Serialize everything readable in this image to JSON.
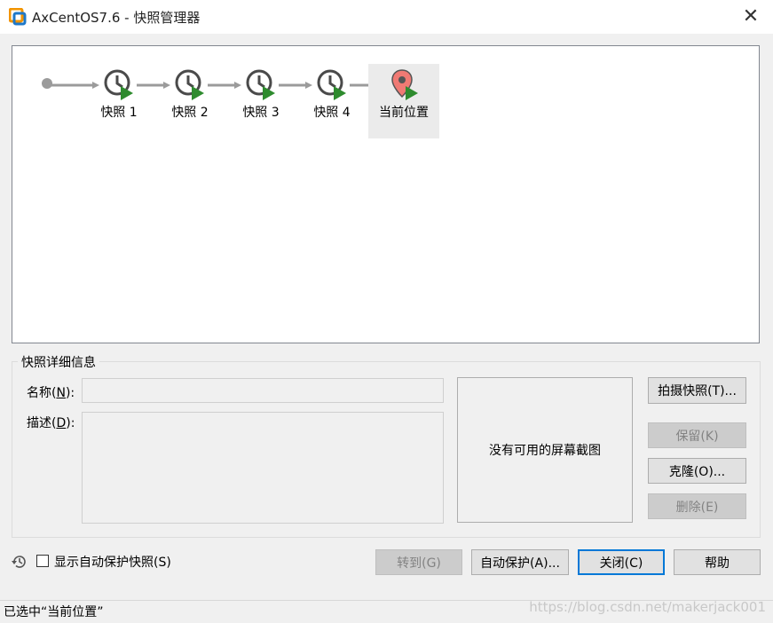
{
  "window": {
    "title": "AxCentOS7.6 - 快照管理器",
    "close_icon": "close-icon"
  },
  "tree": {
    "nodes": [
      {
        "label": "快照 1",
        "icon": "snapshot-clock-icon"
      },
      {
        "label": "快照 2",
        "icon": "snapshot-clock-icon"
      },
      {
        "label": "快照 3",
        "icon": "snapshot-clock-icon"
      },
      {
        "label": "快照 4",
        "icon": "snapshot-clock-icon"
      },
      {
        "label": "当前位置",
        "icon": "current-location-pin-icon",
        "selected": true
      }
    ],
    "colors": {
      "arrow": "#9b9b9b",
      "clock": "#4a4a4a",
      "play": "#2e8b2e",
      "pin": "#f07a74"
    }
  },
  "details": {
    "group_title": "快照详细信息",
    "name_label": "名称",
    "name_mnemonic": "N",
    "name_value": "",
    "desc_label": "描述",
    "desc_mnemonic": "D",
    "desc_value": "",
    "no_screenshot": "没有可用的屏幕截图"
  },
  "side_buttons": {
    "take": "拍摄快照(T)...",
    "keep": "保留(K)",
    "clone": "克隆(O)...",
    "delete": "删除(E)"
  },
  "bottom": {
    "history_icon": "history-icon",
    "show_autoprotect_label": "显示自动保护快照(S)",
    "show_autoprotect_checked": false,
    "goto": "转到(G)",
    "autoprotect": "自动保护(A)...",
    "close": "关闭(C)",
    "help": "帮助"
  },
  "status": {
    "text": "已选中“当前位置”",
    "watermark": "https://blog.csdn.net/makerjack001"
  }
}
